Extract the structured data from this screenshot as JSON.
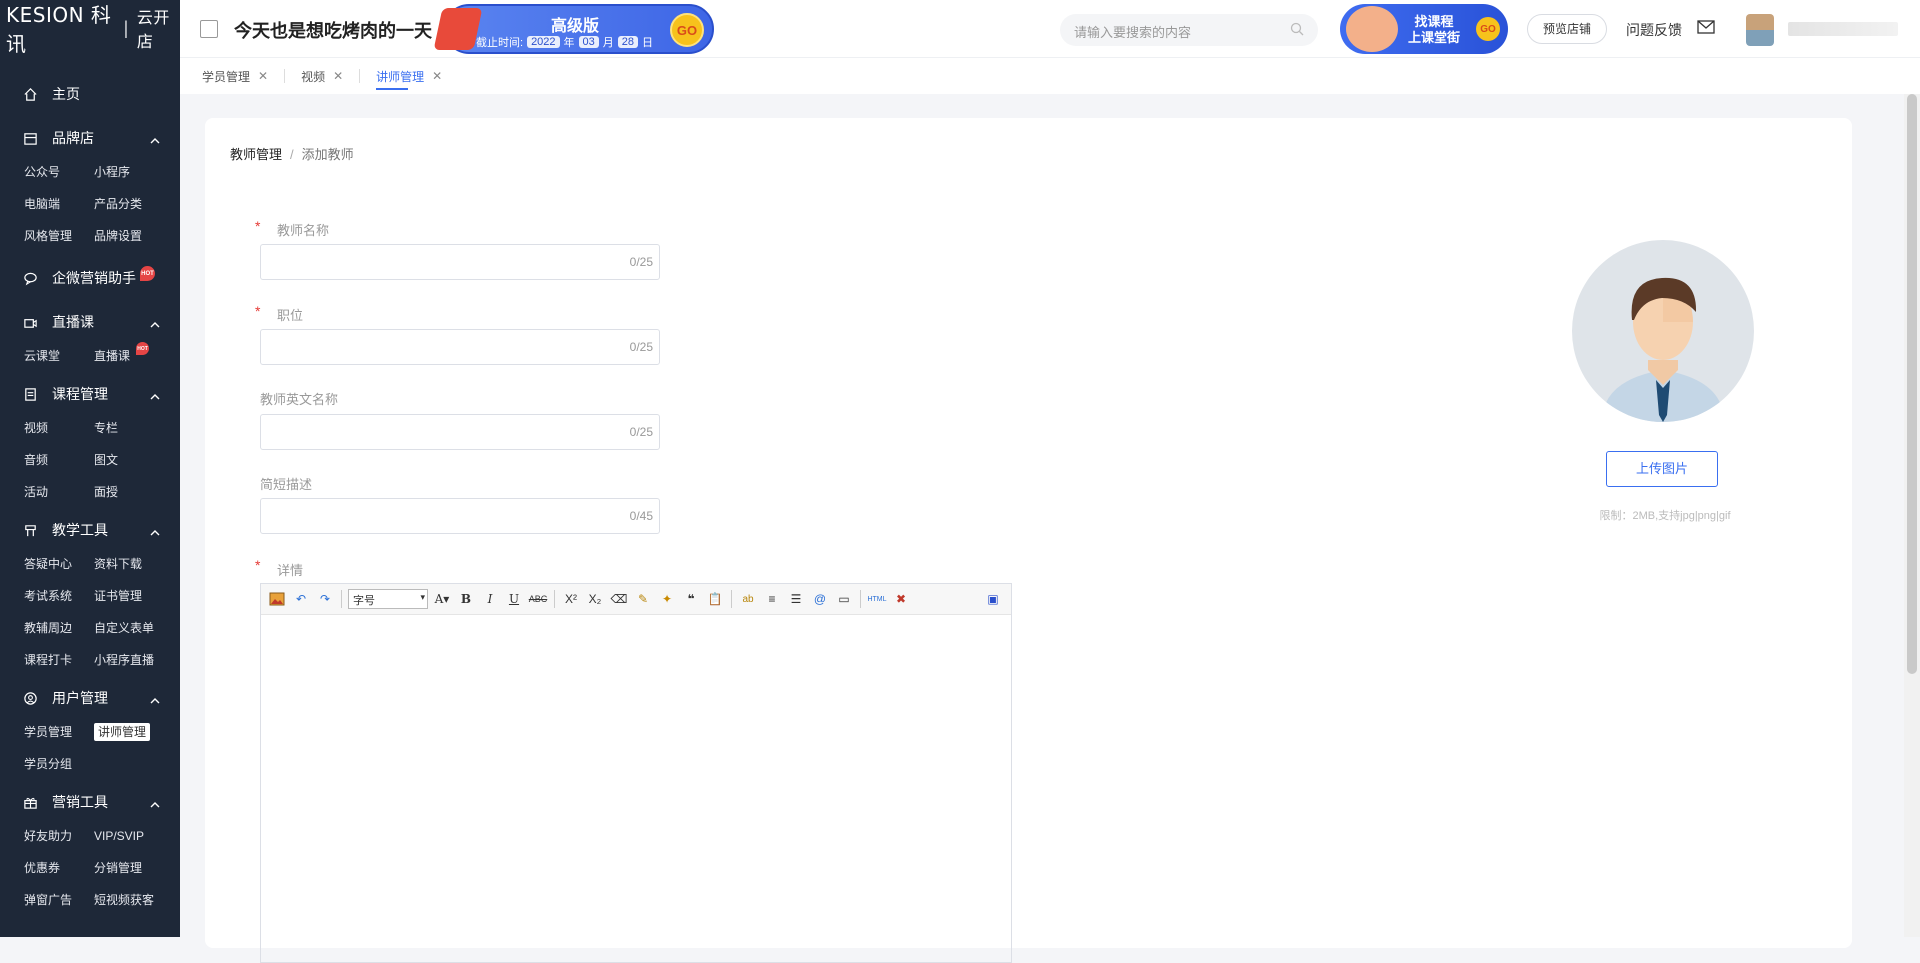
{
  "brand": {
    "name": "KESION 科讯",
    "product": "云开店"
  },
  "sidebar": {
    "home": "主页",
    "groups": [
      {
        "title": "品牌店",
        "icon": "store-icon",
        "items": [
          "公众号",
          "小程序",
          "电脑端",
          "产品分类",
          "风格管理",
          "品牌设置"
        ]
      },
      {
        "title": "企微营销助手",
        "icon": "chat-icon",
        "items": []
      },
      {
        "title": "直播课",
        "icon": "camera-icon",
        "items": [
          "云课堂",
          "直播课"
        ]
      },
      {
        "title": "课程管理",
        "icon": "document-icon",
        "items": [
          "视频",
          "专栏",
          "音频",
          "图文",
          "活动",
          "面授"
        ]
      },
      {
        "title": "教学工具",
        "icon": "tools-icon",
        "items": [
          "答疑中心",
          "资料下载",
          "考试系统",
          "证书管理",
          "教辅周边",
          "自定义表单",
          "课程打卡",
          "小程序直播"
        ]
      },
      {
        "title": "用户管理",
        "icon": "user-icon",
        "items": [
          "学员管理",
          "讲师管理",
          "学员分组"
        ]
      },
      {
        "title": "营销工具",
        "icon": "gift-icon",
        "items": [
          "好友助力",
          "VIP/SVIP",
          "优惠券",
          "分销管理",
          "弹窗广告",
          "短视频获客"
        ]
      }
    ],
    "hot_badge": "HOT"
  },
  "topbar": {
    "shop_title": "今天也是想吃烤肉的一天",
    "promo": {
      "title": "高级版",
      "deadline_label": "截止时间:",
      "year": "2022",
      "year_unit": "年",
      "month": "03",
      "month_unit": "月",
      "day": "28",
      "day_unit": "日",
      "go": "GO"
    },
    "search_placeholder": "请输入要搜索的内容",
    "course_banner": {
      "line1": "找课程",
      "line2": "上课堂街",
      "go": "GO"
    },
    "preview_shop": "预览店铺",
    "feedback": "问题反馈"
  },
  "tabs": [
    {
      "label": "学员管理",
      "active": false
    },
    {
      "label": "视频",
      "active": false
    },
    {
      "label": "讲师管理",
      "active": true
    }
  ],
  "breadcrumb": {
    "parent": "教师管理",
    "separator": "/",
    "current": "添加教师"
  },
  "form": {
    "teacher_name": {
      "label": "教师名称",
      "required": true,
      "counter": "0/25",
      "value": ""
    },
    "position": {
      "label": "职位",
      "required": true,
      "counter": "0/25",
      "value": ""
    },
    "english_name": {
      "label": "教师英文名称",
      "required": false,
      "counter": "0/25",
      "value": ""
    },
    "short_desc": {
      "label": "简短描述",
      "required": false,
      "counter": "0/45",
      "value": ""
    },
    "details": {
      "label": "详情",
      "required": true,
      "font_size_select": "字号"
    }
  },
  "upload": {
    "button": "上传图片",
    "limit": "限制：2MB,支持jpg|png|gif"
  },
  "colors": {
    "sidebar_bg": "#1e2838",
    "accent": "#3a6ff0",
    "required": "#e53935"
  }
}
